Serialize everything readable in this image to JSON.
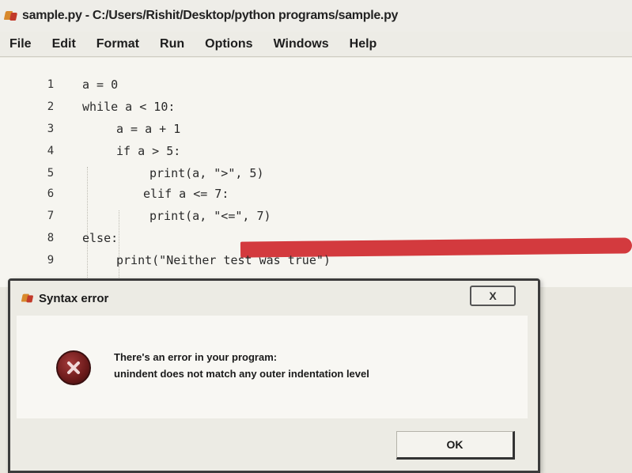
{
  "window": {
    "title": "sample.py - C:/Users/Rishit/Desktop/python programs/sample.py"
  },
  "menu": [
    "File",
    "Edit",
    "Format",
    "Run",
    "Options",
    "Windows",
    "Help"
  ],
  "code": [
    {
      "n": "1",
      "text": "a = 0"
    },
    {
      "n": "2",
      "text": "while a < 10:"
    },
    {
      "n": "3",
      "text": "a = a + 1"
    },
    {
      "n": "4",
      "text": "if a > 5:"
    },
    {
      "n": "5",
      "text": "print(a, \">\", 5)"
    },
    {
      "n": "6",
      "text": "elif a <= 7:"
    },
    {
      "n": "7",
      "text": "print(a, \"<=\", 7)"
    },
    {
      "n": "8",
      "text": "else:"
    },
    {
      "n": "9",
      "text": "print(\"Neither test was true\")"
    }
  ],
  "dialog": {
    "title": "Syntax error",
    "close_label": "X",
    "message_line1": "There's an error in your program:",
    "message_line2": "unindent does not match any outer indentation level",
    "ok_label": "OK"
  },
  "colors": {
    "error_highlight": "#d33a3e",
    "error_icon": "#6b1a1a"
  },
  "icons": {
    "app": "idle-python-icon",
    "error": "error-x-icon"
  }
}
